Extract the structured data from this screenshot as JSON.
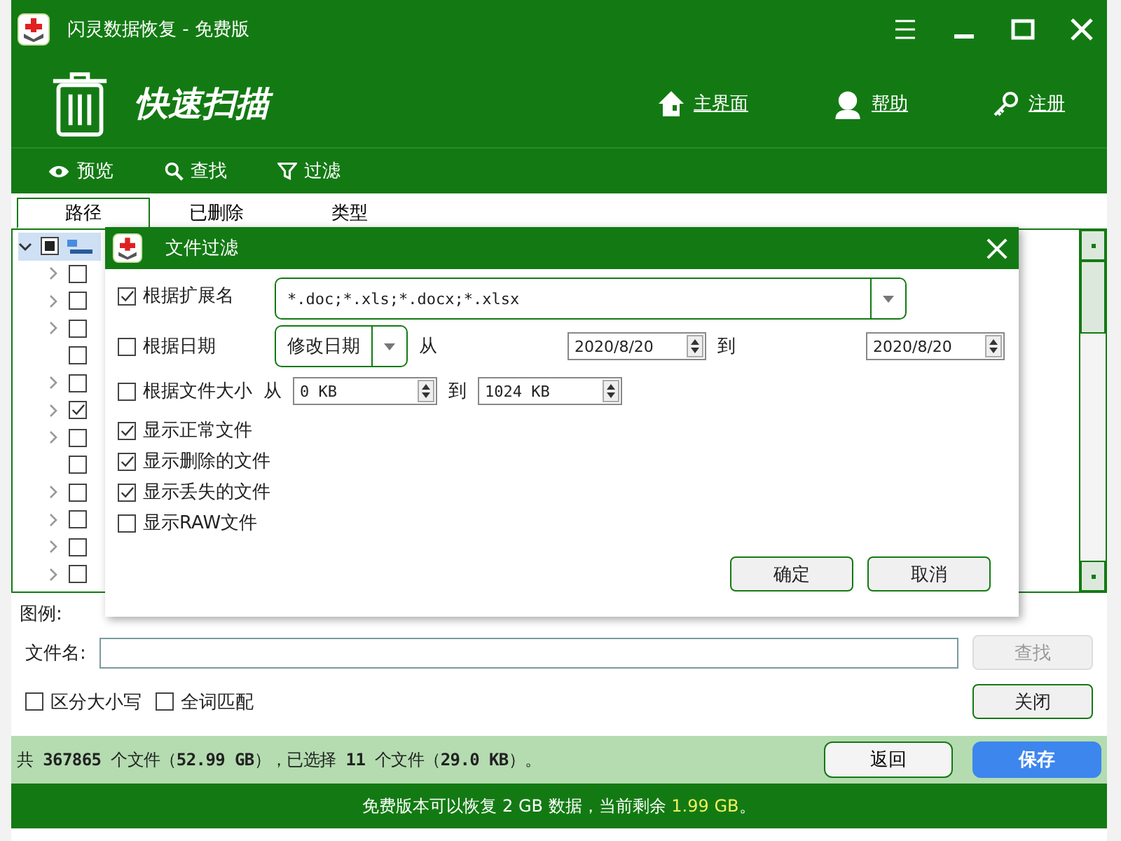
{
  "window": {
    "title": "闪灵数据恢复 - 免费版"
  },
  "header": {
    "title": "快速扫描",
    "links": [
      "主界面",
      "帮助",
      "注册"
    ]
  },
  "toolbar": [
    "预览",
    "查找",
    "过滤"
  ],
  "tabs": [
    {
      "label": "路径",
      "selected": true
    },
    {
      "label": "已删除",
      "selected": false
    },
    {
      "label": "类型",
      "selected": false
    }
  ],
  "tree": {
    "expanded": true,
    "partial": true,
    "children": [
      {
        "has_children": true,
        "checked": false
      },
      {
        "has_children": true,
        "checked": false
      },
      {
        "has_children": true,
        "checked": false
      },
      {
        "has_children": false,
        "checked": false
      },
      {
        "has_children": true,
        "checked": false
      },
      {
        "has_children": true,
        "checked": true
      },
      {
        "has_children": true,
        "checked": false
      },
      {
        "has_children": false,
        "checked": false
      },
      {
        "has_children": true,
        "checked": false
      },
      {
        "has_children": true,
        "checked": false
      },
      {
        "has_children": true,
        "checked": false
      },
      {
        "has_children": true,
        "checked": false
      }
    ]
  },
  "dialog": {
    "title": "文件过滤",
    "extension": {
      "label": "根据扩展名",
      "checked": true,
      "value": "*.doc;*.xls;*.docx;*.xlsx"
    },
    "date": {
      "label": "根据日期",
      "checked": false,
      "field": "修改日期",
      "from_label": "从",
      "from": "2020/8/20",
      "to_label": "到",
      "to": "2020/8/20"
    },
    "size": {
      "label": "根据文件大小",
      "checked": false,
      "from_label": "从",
      "from": "0 KB",
      "to_label": "到",
      "to": "1024 KB"
    },
    "options": [
      {
        "label": "显示正常文件",
        "checked": true
      },
      {
        "label": "显示删除的文件",
        "checked": true
      },
      {
        "label": "显示丢失的文件",
        "checked": true
      },
      {
        "label": "显示RAW文件",
        "checked": false
      }
    ],
    "buttons": [
      "确定",
      "取消"
    ]
  },
  "legend": "图例:",
  "search": {
    "label": "文件名:",
    "find_button": {
      "label": "查找",
      "disabled": true
    },
    "options": [
      {
        "label": "区分大小写",
        "checked": false
      },
      {
        "label": "全词匹配",
        "checked": false
      }
    ],
    "close_button": "关闭"
  },
  "status": {
    "text": "共 **367865** 个文件（**52.99 GB**），已选择 **11** 个文件（**29.0 KB**）。",
    "buttons": [
      {
        "label": "返回",
        "primary": false
      },
      {
        "label": "保存",
        "primary": true
      }
    ]
  },
  "footer": {
    "text": "免费版本可以恢复 2 GB 数据，当前剩余 ",
    "remaining": "1.99 GB",
    "suffix": "。"
  }
}
